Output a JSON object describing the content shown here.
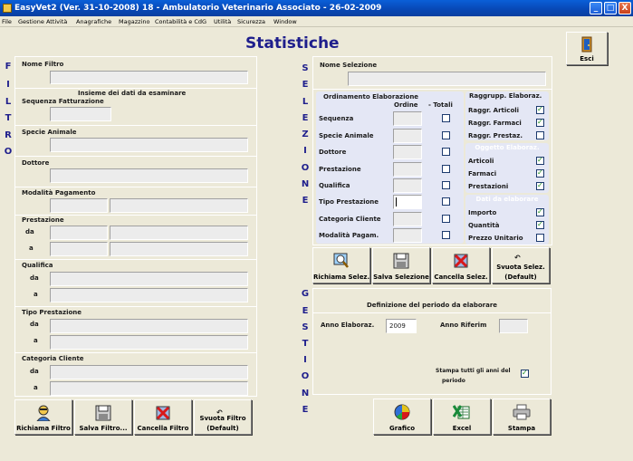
{
  "window": {
    "title": "EasyVet2 (Ver. 31-10-2008)   18 - Ambulatorio Veterinario Associato   -   26-02-2009",
    "minimize": "_",
    "maximize": "□",
    "close": "X"
  },
  "menu": [
    "File",
    "Gestione Attività",
    "Anagrafiche",
    "Magazzino",
    "Contabilità e CdG",
    "Utilità",
    "Sicurezza",
    "Window"
  ],
  "page_title": "Statistiche",
  "side_labels": {
    "filtro": [
      "F",
      "I",
      "L",
      "T",
      "R",
      "O"
    ],
    "selezione": [
      "S",
      "E",
      "L",
      "E",
      "Z",
      "I",
      "O",
      "N",
      "E"
    ],
    "gestione": [
      "G",
      "E",
      "S",
      "T",
      "I",
      "O",
      "N",
      "E"
    ]
  },
  "filtro": {
    "nome_filtro": "Nome Filtro",
    "insieme_dati": "Insieme dei dati da esaminare",
    "sequenza_fatturazione": "Sequenza Fatturazione",
    "specie_animale": "Specie Animale",
    "dottore": "Dottore",
    "modalita_pagamento": "Modalità Pagamento",
    "prestazione": "Prestazione",
    "qualifica": "Qualifica",
    "tipo_prestazione": "Tipo Prestazione",
    "categoria_cliente": "Categoria Cliente",
    "da": "da",
    "a": "a"
  },
  "filtro_buttons": {
    "richiama": "Richiama Filtro",
    "salva": "Salva Filtro...",
    "cancella": "Cancella Filtro",
    "svuota_line1": "Svuota Filtro",
    "svuota_line2": "(Default)"
  },
  "selezione": {
    "nome_selezione": "Nome Selezione",
    "ordinamento_title": "Ordinamento Elaborazione",
    "col_ordine": "Ordine",
    "col_totali": "- Totali",
    "rows": [
      "Sequenza",
      "Specie Animale",
      "Dottore",
      "Prestazione",
      "Qualifica",
      "Tipo Prestazione",
      "Categoria Cliente",
      "Modalità Pagam."
    ],
    "totali_checked": [
      false,
      false,
      false,
      false,
      false,
      false,
      false,
      false
    ],
    "raggrupp_title": "Raggrupp. Elaboraz.",
    "raggrupp": [
      {
        "label": "Raggr. Articoli",
        "checked": true
      },
      {
        "label": "Raggr. Farmaci",
        "checked": true
      },
      {
        "label": "Raggr. Prestaz.",
        "checked": false
      }
    ],
    "oggetto_title": "Oggetto Elaboraz.",
    "oggetto": [
      {
        "label": "Articoli",
        "checked": true
      },
      {
        "label": "Farmaci",
        "checked": true
      },
      {
        "label": "Prestazioni",
        "checked": true
      }
    ],
    "dati_title": "Dati da elaborare",
    "dati": [
      {
        "label": "Importo",
        "checked": true
      },
      {
        "label": "Quantità",
        "checked": true
      },
      {
        "label": "Prezzo Unitario",
        "checked": false
      }
    ]
  },
  "selezione_buttons": {
    "richiama": "Richiama Selez.",
    "salva": "Salva Selezione",
    "cancella": "Cancella Selez.",
    "svuota_line1": "Svuota Selez.",
    "svuota_line2": "(Default)"
  },
  "gestione": {
    "periodo_title": "Definizione del periodo da elaborare",
    "anno_elaboraz_label": "Anno Elaboraz.",
    "anno_elaboraz_value": "2009",
    "anno_riferim_label": "Anno Riferim",
    "anno_riferim_value": "",
    "stampa_tutti_line1": "Stampa tutti gli anni del",
    "stampa_tutti_line2": "periodo",
    "stampa_tutti_checked": true
  },
  "gestione_buttons": {
    "grafico": "Grafico",
    "excel": "Excel",
    "stampa": "Stampa"
  },
  "esci": "Esci"
}
